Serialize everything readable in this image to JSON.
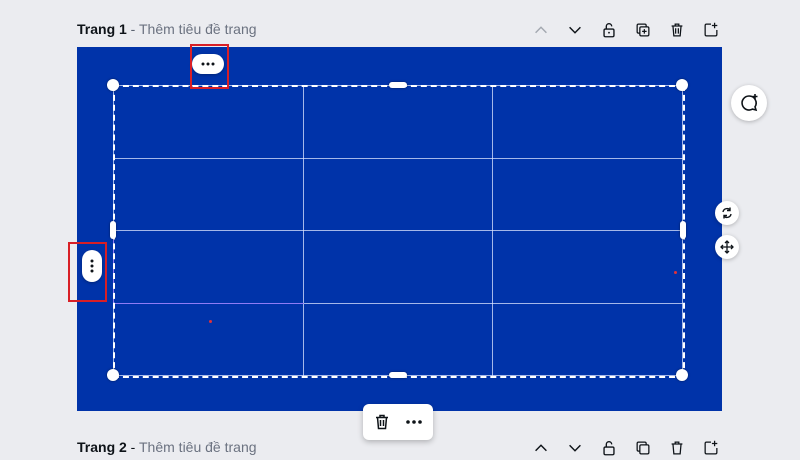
{
  "page1": {
    "title": "Trang 1",
    "separator": " - ",
    "subtitle": "Thêm tiêu đề trang"
  },
  "page2": {
    "title": "Trang 2",
    "separator": " - ",
    "subtitle": "Thêm tiêu đề trang"
  },
  "page_tools": [
    {
      "icon": "chevron-up-icon"
    },
    {
      "icon": "chevron-down-icon"
    },
    {
      "icon": "unlock-icon"
    },
    {
      "icon": "duplicate-page-icon"
    },
    {
      "icon": "trash-icon"
    },
    {
      "icon": "add-page-icon"
    }
  ],
  "canvas": {
    "background": "#0033a9"
  },
  "table": {
    "rows": 4,
    "columns": 3,
    "cells": [
      [
        "",
        "",
        ""
      ],
      [
        "",
        "",
        ""
      ],
      [
        "",
        "",
        ""
      ],
      [
        "",
        "",
        ""
      ]
    ]
  },
  "side_buttons": [
    {
      "icon": "add-comment-icon"
    },
    {
      "icon": "rotate-icon"
    },
    {
      "icon": "move-icon"
    }
  ],
  "floating_toolbar": [
    {
      "icon": "trash-icon"
    },
    {
      "icon": "more-options-icon"
    }
  ],
  "highlight_color": "#d81f26"
}
